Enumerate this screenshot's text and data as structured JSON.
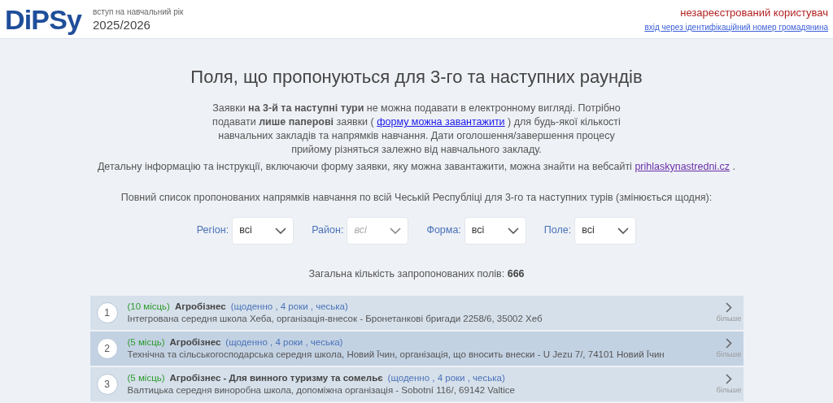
{
  "header": {
    "logo": "DiPSy",
    "subtitle": "вступ на навчальний рік",
    "year": "2025/2026",
    "user": "незареєстрований користувач",
    "login_link": "вхід через ідентифікаційний номер громадянина"
  },
  "title": "Поля, що пропонуються для 3-го та наступних раундів",
  "intro": {
    "before": "Заявки **на 3-й та наступні тури** не можна подавати в електронному вигляді. Потрібно подавати **лише паперові** заявки (",
    "link": "форму можна завантажити",
    "after": ") для будь-якої кількості навчальних закладів та напрямків навчання. Дати оголошення/завершення процесу прийому різняться залежно від навчального закладу."
  },
  "details": {
    "text": "Детальну інформацію та інструкції, включаючи форму заявки, яку можна завантажити, можна знайти на вебсайті",
    "link": "prihlaskynastredni.cz",
    "end": "."
  },
  "list_intro": "Повний список пропонованих напрямків навчання по всій Чеській Республіці для 3-го та наступних турів (змінюється щодня):",
  "filters": [
    {
      "label": "Регіон:",
      "value": "всі",
      "disabled": false
    },
    {
      "label": "Район:",
      "value": "всі",
      "disabled": true
    },
    {
      "label": "Форма:",
      "value": "всі",
      "disabled": false
    },
    {
      "label": "Поле:",
      "value": "всі",
      "disabled": false
    }
  ],
  "total": {
    "label": "Загальна кількість запропонованих полів:",
    "value": "666"
  },
  "rows": [
    {
      "number": "1",
      "places": "(10 місць)",
      "name": "Агробізнес",
      "meta": "(щоденно , 4 роки , чеська)",
      "school": "Інтегрована середня школа Хеба, організація-внесок - Бронетанкові бригади 2258/6, 35002 Хеб",
      "more": "більше",
      "selected": false
    },
    {
      "number": "2",
      "places": "(5 місць)",
      "name": "Агробізнес",
      "meta": "(щоденно , 4 роки , чеська)",
      "school": "Технічна та сільськогосподарська середня школа, Новий Їчин, організація, що вносить внески - U Jezu 7/, 74101 Новий Їчин",
      "more": "більше",
      "selected": true
    },
    {
      "number": "3",
      "places": "(5 місць)",
      "name": "Агробізнес - Для винного туризму та сомельє",
      "meta": "(щоденно , 4 роки , чеська)",
      "school": "Валтицька середня виноробна школа, допоміжна організація - Sobotní 116/, 69142 Valtice",
      "more": "більше",
      "selected": false
    }
  ]
}
